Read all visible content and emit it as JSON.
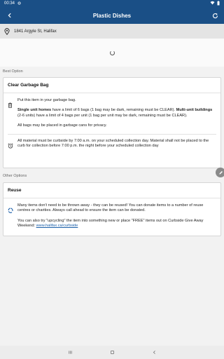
{
  "status_bar": {
    "time": "00:34"
  },
  "app_bar": {
    "title": "Plastic Dishes"
  },
  "address": {
    "text": "1841 Argyle St, Halifax"
  },
  "best_option": {
    "section_label": "Best Option",
    "card_title": "Clear Garbage Bag",
    "instruction": "Put this item in your garbage bag.",
    "limits_single_bold": "Single unit homes",
    "limits_single_text": " have a limit of 6 bags (1 bag may be dark, remaining must be CLEAR). ",
    "limits_multi_bold": "Multi-unit buildings",
    "limits_multi_text": " (2-6 units) have a limit of 4 bags per unit (1 bag per unit may be dark, remaining must be CLEAR).",
    "privacy": "All bags may be placed in garbage cans for privacy.",
    "timing": "All material must be curbside by 7:00 a.m. on your scheduled collection day. Material shall not be placed to the curb for collection before 7:00 p.m. the night before your scheduled collection day"
  },
  "other_options": {
    "section_label": "Other Options",
    "card_title": "Reuse",
    "reuse_text": "Many items don't need to be thrown away - they can be reused! You can donate items to a number of reuse centres or charities. Always call ahead to ensure the item can be donated.",
    "upcycle_text": "You can also try \"upcycling\" the item into something new or place \"FREE\" items out on Curbside Give Away Weekend: ",
    "upcycle_link": "www.halifax.ca/curbside"
  },
  "icons": {
    "back": "arrow-left-icon",
    "refresh": "refresh-icon",
    "pin": "location-pin-icon",
    "trash": "trash-can-icon",
    "alarm": "alarm-clock-icon",
    "recycle": "recycle-icon",
    "edit": "pencil-icon"
  },
  "colors": {
    "app_bar": "#1a4f86",
    "link": "#1a5ea8",
    "recycle": "#1a5ea8"
  }
}
